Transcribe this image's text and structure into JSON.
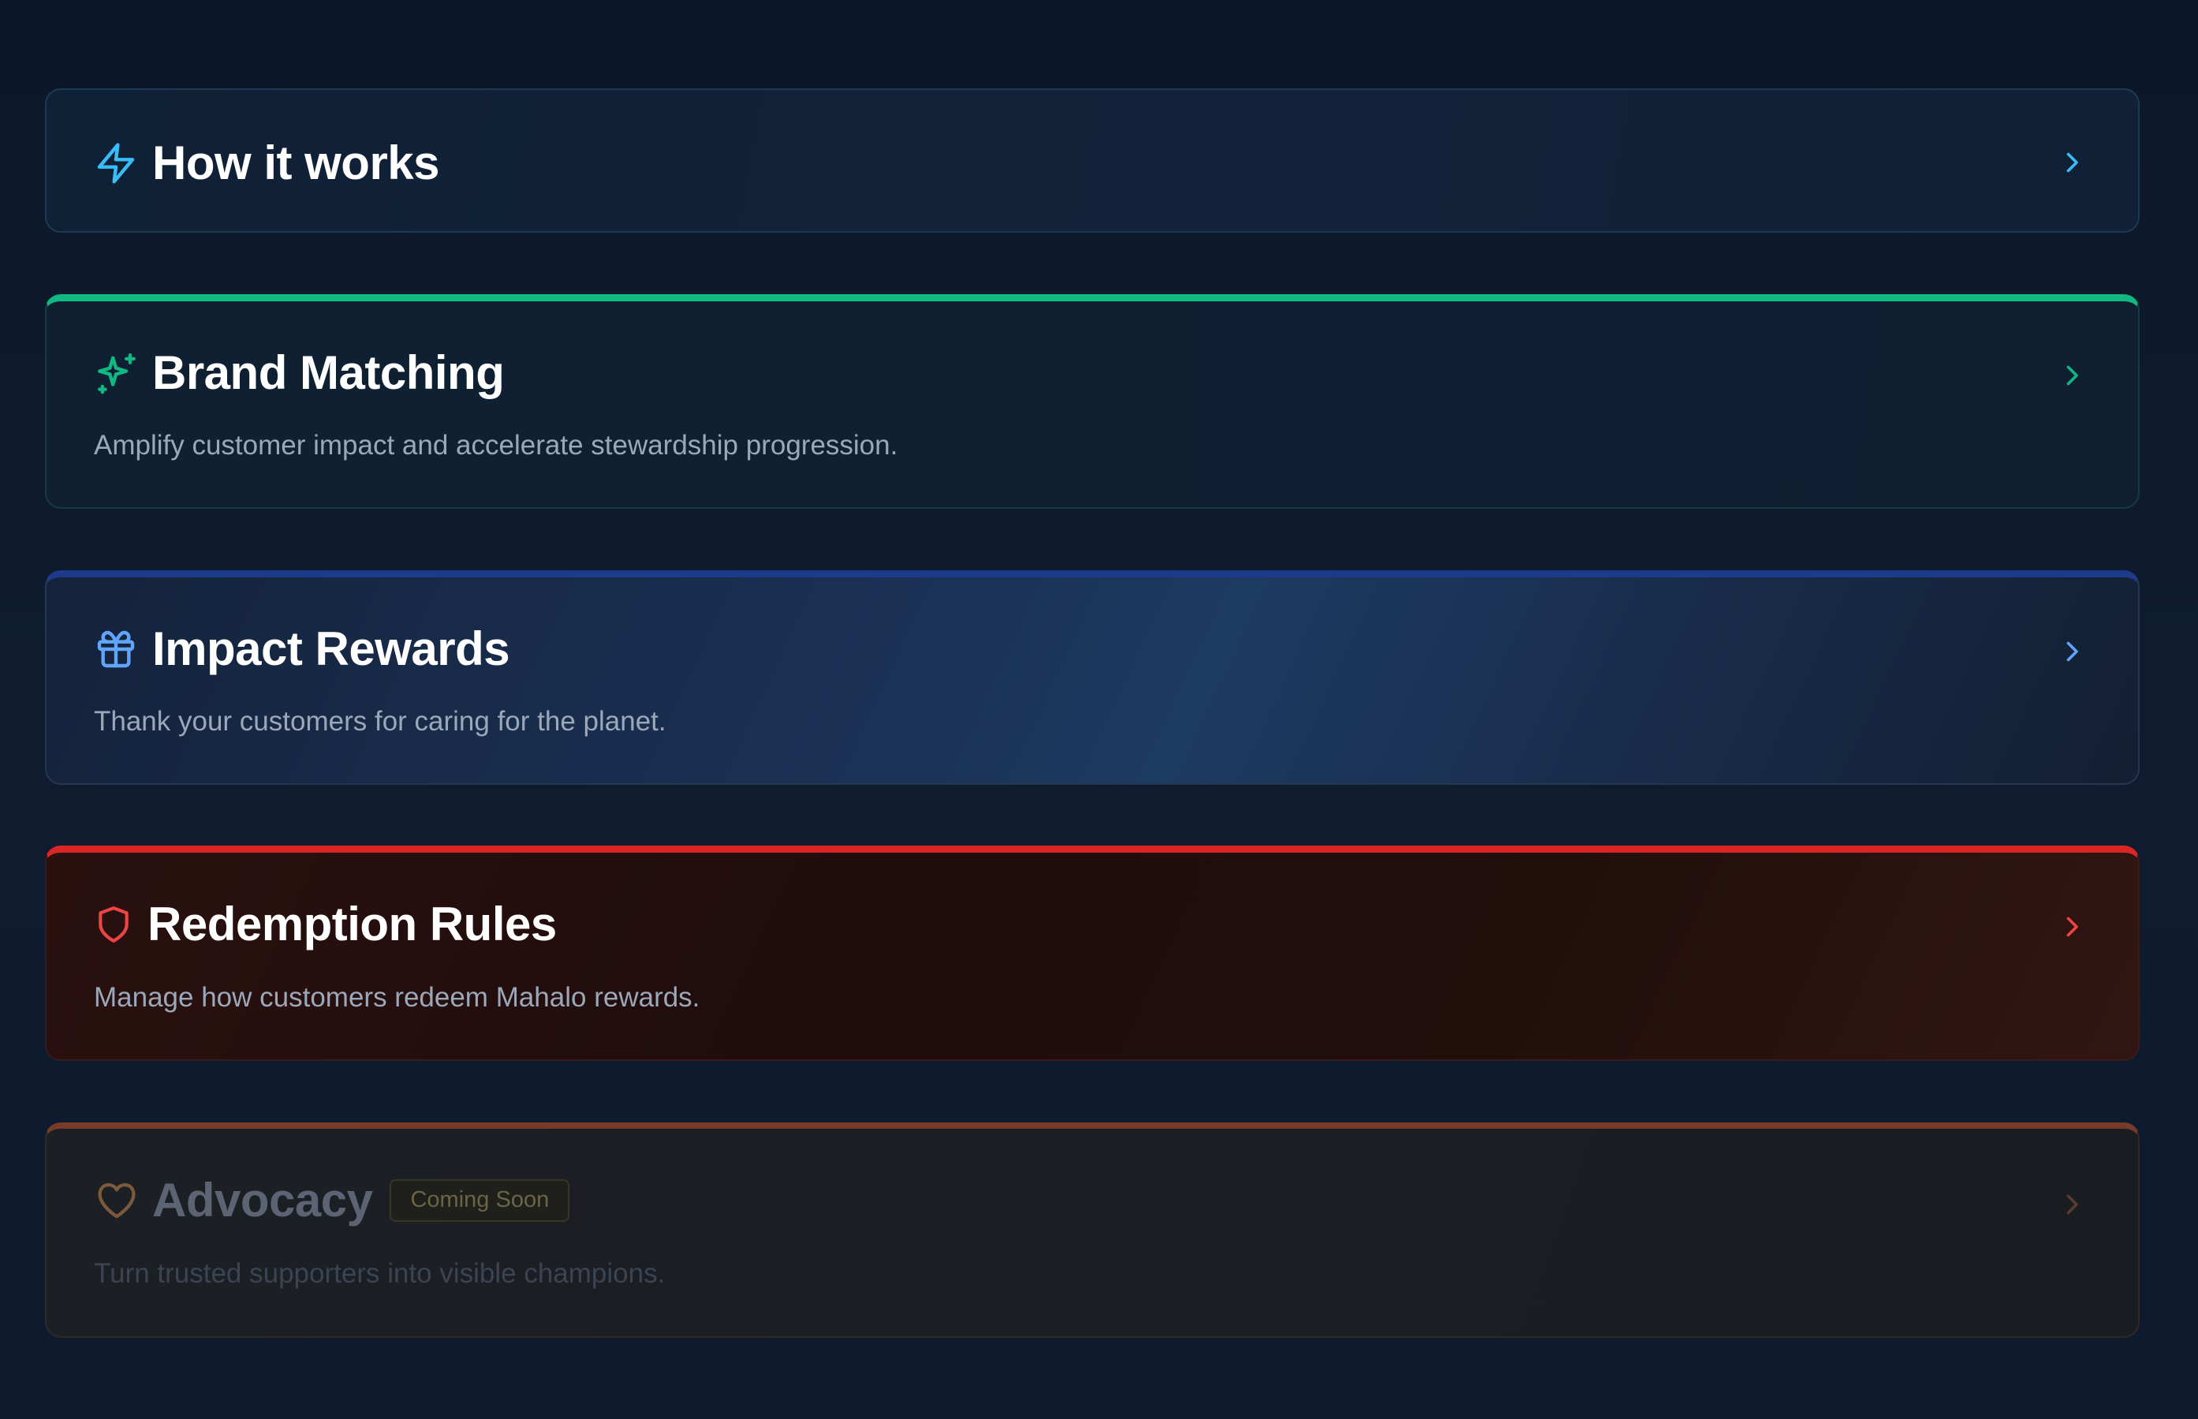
{
  "cards": [
    {
      "id": "how-it-works",
      "title": "How it works",
      "description": "",
      "icon": "lightning-bolt-icon",
      "accent": "#38bdf8"
    },
    {
      "id": "brand-matching",
      "title": "Brand Matching",
      "description": "Amplify customer impact and accelerate stewardship progression.",
      "icon": "sparkles-icon",
      "accent": "#10b981"
    },
    {
      "id": "impact-rewards",
      "title": "Impact Rewards",
      "description": "Thank your customers for caring for the planet.",
      "icon": "gift-icon",
      "accent": "#60a5fa"
    },
    {
      "id": "redemption-rules",
      "title": "Redemption Rules",
      "description": "Manage how customers redeem Mahalo rewards.",
      "icon": "shield-icon",
      "accent": "#ef4444"
    },
    {
      "id": "advocacy",
      "title": "Advocacy",
      "badge": "Coming Soon",
      "description": "Turn trusted supporters into visible champions.",
      "icon": "heart-icon",
      "accent": "#7a3a28",
      "disabled": true
    }
  ]
}
